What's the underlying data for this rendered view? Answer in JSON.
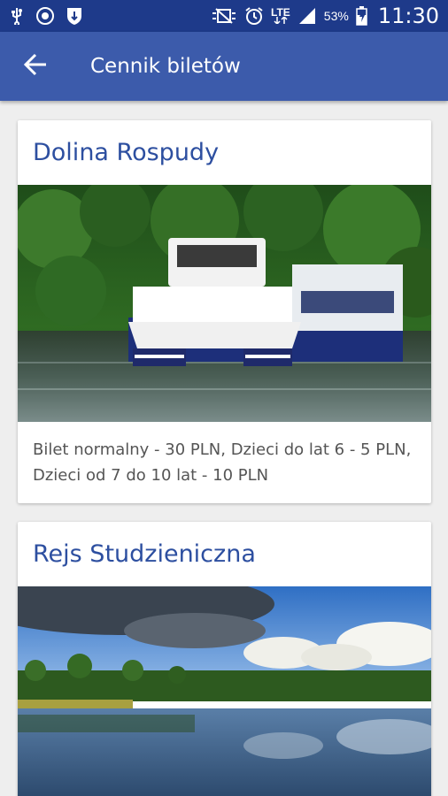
{
  "status_bar": {
    "battery": "53%",
    "network": "LTE",
    "time": "11:30",
    "icons": [
      "usb-icon",
      "sync-icon",
      "shield-icon",
      "mute-icon",
      "alarm-icon",
      "lte-icon",
      "signal-icon",
      "battery-icon"
    ]
  },
  "app_bar": {
    "title": "Cennik biletów",
    "back_icon": "arrow-back-icon",
    "color": "#3c5bab"
  },
  "cards": [
    {
      "title": "Dolina Rospudy",
      "image": "boat-on-river-photo",
      "description": "Bilet normalny - 30 PLN, Dzieci do lat 6 - 5 PLN, Dzieci od 7 do 10 lat - 10 PLN"
    },
    {
      "title": "Rejs Studzieniczna",
      "image": "lake-landscape-photo"
    }
  ],
  "colors": {
    "accent": "#2d4fa0",
    "status_bar": "#1e3a8a",
    "background": "#eeeeee"
  }
}
